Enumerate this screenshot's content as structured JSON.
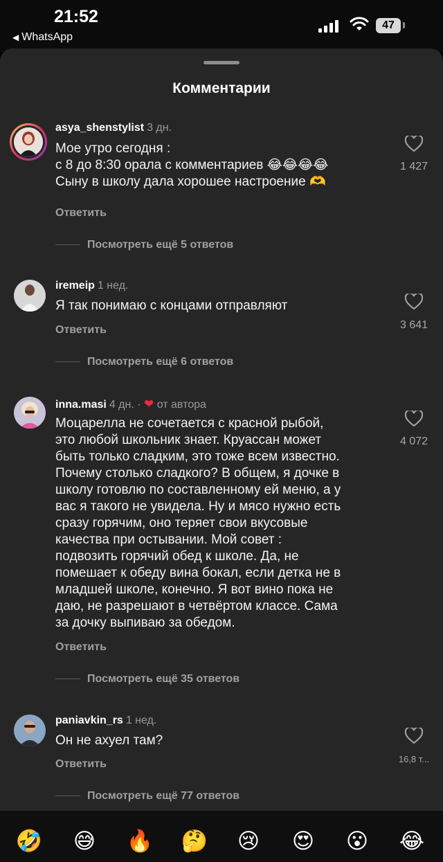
{
  "status": {
    "time": "21:52",
    "back_app": "WhatsApp",
    "battery": "47"
  },
  "sheet": {
    "title": "Комментарии"
  },
  "comments": [
    {
      "username": "asya_shenstylist",
      "when": "3 дн.",
      "text": "Мое утро сегодня :\nс 8 до 8:30 орала с комментариев 😂😂😂😂\nСыну в школу дала хорошее настроение 🫶",
      "reply": "Ответить",
      "more": "Посмотреть ещё 5 ответов",
      "likes": "1 427"
    },
    {
      "username": "iremeip",
      "when": "1 нед.",
      "text": "Я так понимаю с концами отправляют",
      "reply": "Ответить",
      "more": "Посмотреть ещё 6 ответов",
      "likes": "3 641"
    },
    {
      "username": "inna.masi",
      "when": "4 дн. ·",
      "author_note": "от автора",
      "text": "Моцарелла не сочетается с красной рыбой,\nэто любой школьник знает. Круассан может\nбыть только сладким, это тоже всем известно.\nПочему столько сладкого? В общем, я дочке в\nшколу готовлю по составленному ей меню, а у\nвас я такого не увидела. Ну и мясо нужно есть\nсразу горячим, оно теряет свои вкусовые\nкачества при остывании. Мой совет :\nподвозить горячий обед к школе. Да, не\nпомешает к обеду вина бокал, если детка не в\nмладшей школе, конечно. Я вот вино пока не\nдаю, не разрешают в четвёртом классе. Сама\nза дочку выпиваю за обедом.",
      "reply": "Ответить",
      "more": "Посмотреть ещё 35 ответов",
      "likes": "4 072"
    },
    {
      "username": "paniavkin_rs",
      "when": "1 нед.",
      "text": "Он не ахуел там?",
      "reply": "Ответить",
      "more": "Посмотреть ещё 77 ответов",
      "likes": "16,8 т..."
    }
  ],
  "emoji_bar": [
    "🤣",
    "😅",
    "🔥",
    "🤔",
    "😢",
    "😍",
    "😮",
    "😂"
  ],
  "colors": {
    "sheet_bg": "#262626",
    "heart_red": "#ed2a3f",
    "muted": "#a0a0a0"
  }
}
